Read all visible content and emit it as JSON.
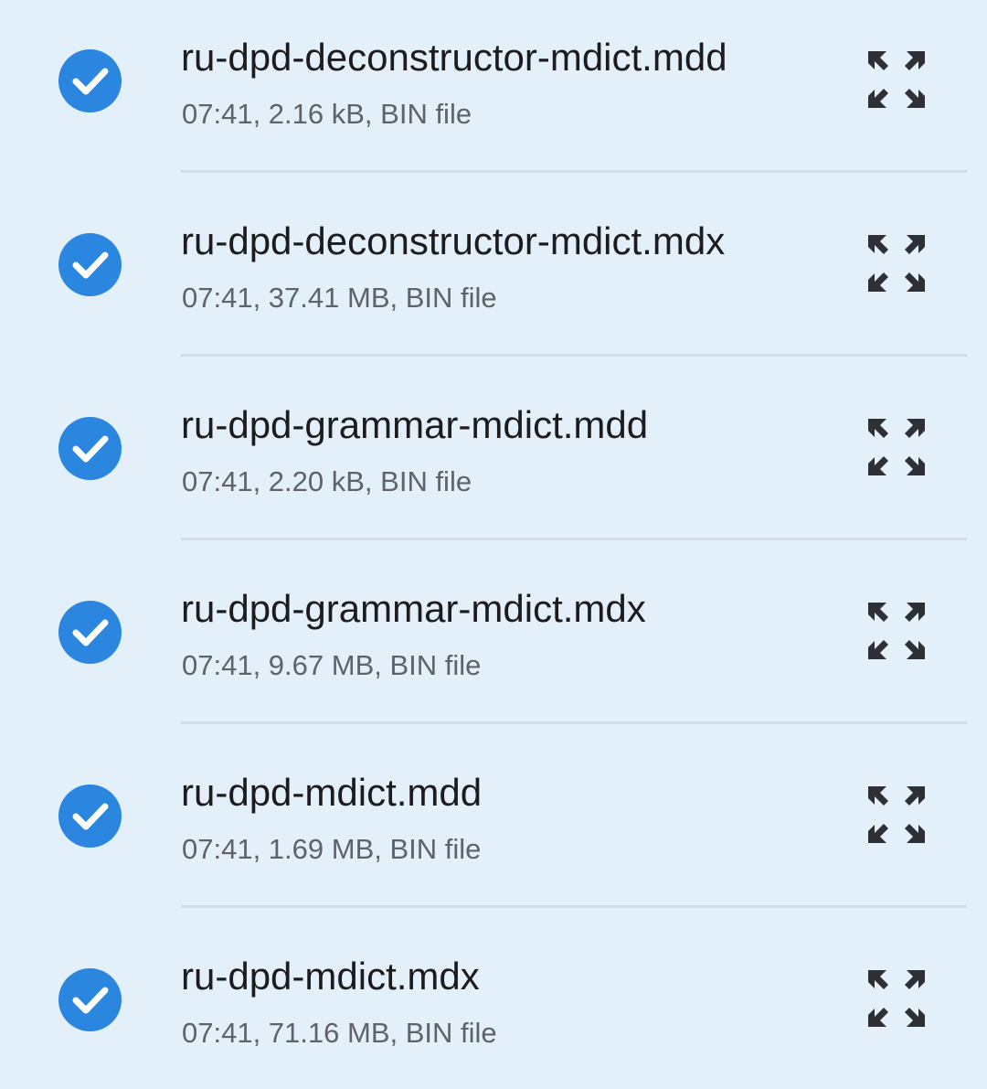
{
  "files": [
    {
      "name": "ru-dpd-deconstructor-mdict.mdd",
      "meta": "07:41, 2.16 kB, BIN file",
      "checked": true
    },
    {
      "name": "ru-dpd-deconstructor-mdict.mdx",
      "meta": "07:41, 37.41 MB, BIN file",
      "checked": true
    },
    {
      "name": "ru-dpd-grammar-mdict.mdd",
      "meta": "07:41, 2.20 kB, BIN file",
      "checked": true
    },
    {
      "name": "ru-dpd-grammar-mdict.mdx",
      "meta": "07:41, 9.67 MB, BIN file",
      "checked": true
    },
    {
      "name": "ru-dpd-mdict.mdd",
      "meta": "07:41, 1.69 MB, BIN file",
      "checked": true
    },
    {
      "name": "ru-dpd-mdict.mdx",
      "meta": "07:41, 71.16 MB, BIN file",
      "checked": true
    }
  ],
  "colors": {
    "background": "#e3f0fa",
    "accent": "#2b86e0",
    "primary_text": "#1c1c1e",
    "secondary_text": "#5f6368",
    "icon": "#2d3035"
  },
  "icons": {
    "check": "check-circle-icon",
    "expand": "expand-arrows-icon"
  }
}
